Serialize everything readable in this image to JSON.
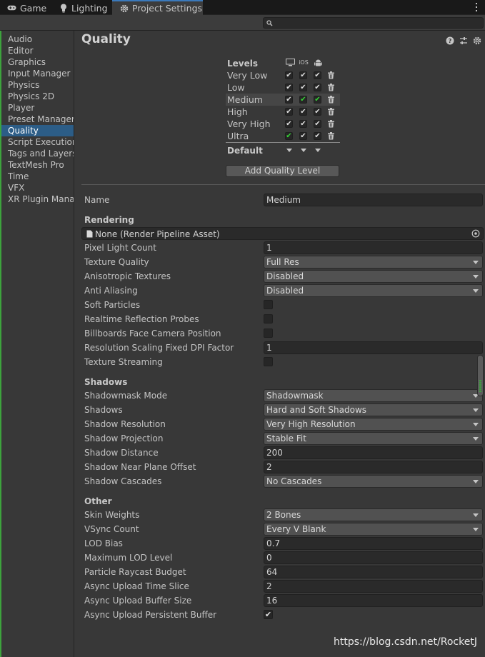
{
  "tabs": [
    {
      "label": "Game",
      "icon": "gamepad-icon"
    },
    {
      "label": "Lighting",
      "icon": "lightbulb-icon"
    },
    {
      "label": "Project Settings",
      "icon": "gear-icon",
      "active": true
    }
  ],
  "search": {
    "placeholder": ""
  },
  "sidebar": {
    "items": [
      {
        "label": "Audio"
      },
      {
        "label": "Editor"
      },
      {
        "label": "Graphics"
      },
      {
        "label": "Input Manager"
      },
      {
        "label": "Physics"
      },
      {
        "label": "Physics 2D"
      },
      {
        "label": "Player"
      },
      {
        "label": "Preset Manager"
      },
      {
        "label": "Quality",
        "selected": true
      },
      {
        "label": "Script Execution"
      },
      {
        "label": "Tags and Layers"
      },
      {
        "label": "TextMesh Pro"
      },
      {
        "label": "Time"
      },
      {
        "label": "VFX"
      },
      {
        "label": "XR Plugin Manag"
      }
    ]
  },
  "page": {
    "title": "Quality"
  },
  "levels": {
    "header": "Levels",
    "platforms": [
      "desktop-icon",
      "iOS",
      "android-icon"
    ],
    "ios_label": "iOS",
    "rows": [
      {
        "name": "Very Low",
        "checks": [
          true,
          true,
          true
        ],
        "green": [
          false,
          false,
          false
        ]
      },
      {
        "name": "Low",
        "checks": [
          true,
          true,
          true
        ],
        "green": [
          false,
          false,
          false
        ]
      },
      {
        "name": "Medium",
        "checks": [
          true,
          true,
          true
        ],
        "green": [
          false,
          true,
          true
        ]
      },
      {
        "name": "High",
        "checks": [
          true,
          true,
          true
        ],
        "green": [
          false,
          false,
          false
        ]
      },
      {
        "name": "Very High",
        "checks": [
          true,
          true,
          true
        ],
        "green": [
          false,
          false,
          false
        ]
      },
      {
        "name": "Ultra",
        "checks": [
          true,
          true,
          true
        ],
        "green": [
          true,
          false,
          false
        ]
      }
    ],
    "default_label": "Default",
    "add_button": "Add Quality Level"
  },
  "name_field": {
    "label": "Name",
    "value": "Medium"
  },
  "rendering": {
    "header": "Rendering",
    "asset": "None (Render Pipeline Asset)",
    "props": [
      {
        "label": "Pixel Light Count",
        "type": "field",
        "value": "1"
      },
      {
        "label": "Texture Quality",
        "type": "dropdown",
        "value": "Full Res"
      },
      {
        "label": "Anisotropic Textures",
        "type": "dropdown",
        "value": "Disabled"
      },
      {
        "label": "Anti Aliasing",
        "type": "dropdown",
        "value": "Disabled"
      },
      {
        "label": "Soft Particles",
        "type": "checkbox",
        "value": ""
      },
      {
        "label": "Realtime Reflection Probes",
        "type": "checkbox",
        "value": ""
      },
      {
        "label": "Billboards Face Camera Position",
        "type": "checkbox",
        "value": ""
      },
      {
        "label": "Resolution Scaling Fixed DPI Factor",
        "type": "field",
        "value": "1"
      },
      {
        "label": "Texture Streaming",
        "type": "checkbox",
        "value": ""
      }
    ]
  },
  "shadows": {
    "header": "Shadows",
    "props": [
      {
        "label": "Shadowmask Mode",
        "type": "dropdown",
        "value": "Shadowmask"
      },
      {
        "label": "Shadows",
        "type": "dropdown",
        "value": "Hard and Soft Shadows"
      },
      {
        "label": "Shadow Resolution",
        "type": "dropdown",
        "value": "Very High Resolution"
      },
      {
        "label": "Shadow Projection",
        "type": "dropdown",
        "value": "Stable Fit"
      },
      {
        "label": "Shadow Distance",
        "type": "field",
        "value": "200"
      },
      {
        "label": "Shadow Near Plane Offset",
        "type": "field",
        "value": "2"
      },
      {
        "label": "Shadow Cascades",
        "type": "dropdown",
        "value": "No Cascades"
      }
    ]
  },
  "other": {
    "header": "Other",
    "props": [
      {
        "label": "Skin Weights",
        "type": "dropdown",
        "value": "2 Bones"
      },
      {
        "label": "VSync Count",
        "type": "dropdown",
        "value": "Every V Blank"
      },
      {
        "label": "LOD Bias",
        "type": "field",
        "value": "0.7"
      },
      {
        "label": "Maximum LOD Level",
        "type": "field",
        "value": "0"
      },
      {
        "label": "Particle Raycast Budget",
        "type": "field",
        "value": "64"
      },
      {
        "label": "Async Upload Time Slice",
        "type": "field",
        "value": "2"
      },
      {
        "label": "Async Upload Buffer Size",
        "type": "field",
        "value": "16"
      },
      {
        "label": "Async Upload Persistent Buffer",
        "type": "checkbox",
        "value": "✔"
      }
    ]
  },
  "watermark": "https://blog.csdn.net/RocketJ",
  "colors": {
    "accent": "#3a79bb",
    "selection": "#2c5d87",
    "green_check": "#35d335"
  }
}
